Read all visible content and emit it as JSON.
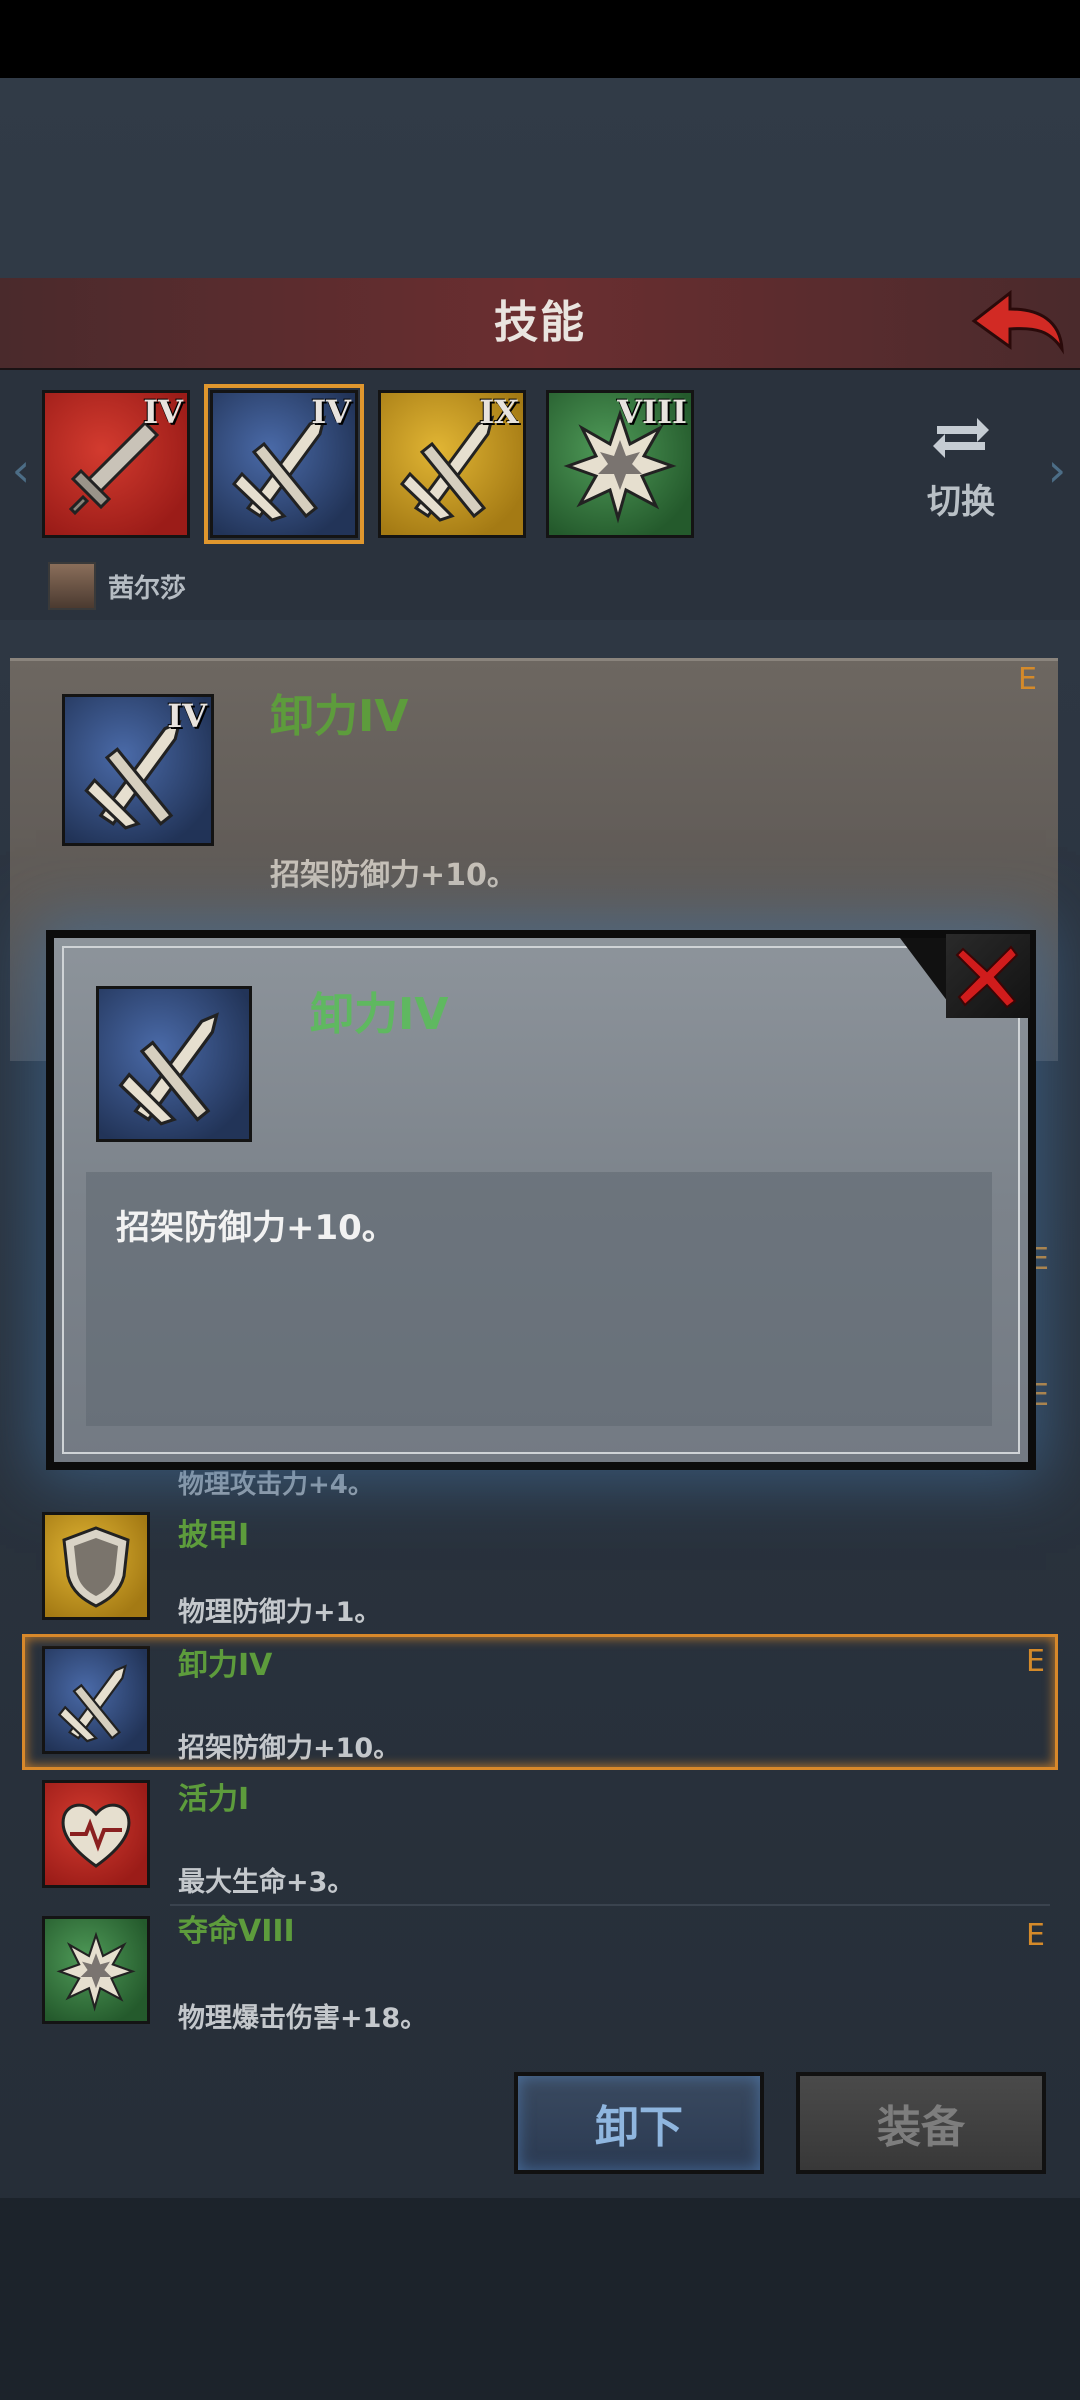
{
  "header": {
    "title": "技能"
  },
  "tabs": [
    {
      "rank": "IV",
      "color": "#b5241e",
      "icon": "sword-icon"
    },
    {
      "rank": "IV",
      "color": "#2f4a7a",
      "icon": "crossed-swords-icon",
      "selected": true
    },
    {
      "rank": "IX",
      "color": "#c8961f",
      "icon": "crossed-swords-icon"
    },
    {
      "rank": "VIII",
      "color": "#377a40",
      "icon": "burst-icon"
    }
  ],
  "switch_label": "切换",
  "character": {
    "name": "茜尔莎"
  },
  "detail": {
    "rank": "IV",
    "title": "卸力IV",
    "desc": "招架防御力+10。",
    "equip_mark": "E"
  },
  "popup": {
    "rank": "",
    "title": "卸力IV",
    "desc": "招架防御力+10。"
  },
  "list": {
    "partial_desc": "物理攻击力+4。",
    "hidden_e_marks": [
      "E",
      "E"
    ],
    "items": [
      {
        "name": "披甲I",
        "desc": "物理防御力+1。",
        "icon": "shield-icon",
        "equipped": ""
      },
      {
        "name": "卸力IV",
        "desc": "招架防御力+10。",
        "icon": "crossed-swords-icon",
        "equipped": "E"
      },
      {
        "name": "活力I",
        "desc": "最大生命+3。",
        "icon": "heart-icon",
        "equipped": ""
      },
      {
        "name": "夺命VIII",
        "desc": "物理爆击伤害+18。",
        "icon": "burst-icon",
        "equipped": "E"
      }
    ]
  },
  "buttons": {
    "unequip": "卸下",
    "equip": "装备"
  },
  "colors": {
    "accent_orange": "#d8882a",
    "skill_green": "#5d9c3c",
    "title_red": "#6b2e30"
  }
}
